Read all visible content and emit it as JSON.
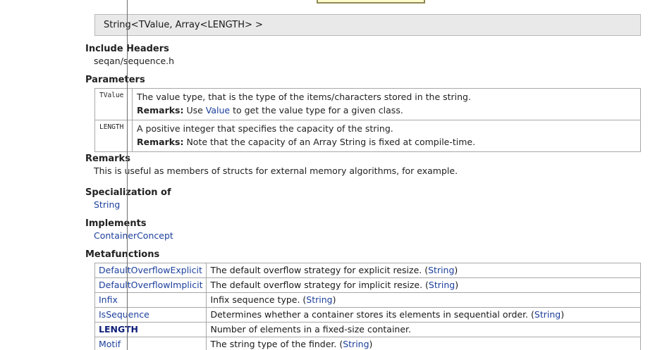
{
  "signature": "String<TValue, Array<LENGTH> >",
  "sections": {
    "include_headers": {
      "heading": "Include Headers",
      "value": "seqan/sequence.h"
    },
    "parameters": {
      "heading": "Parameters",
      "items": [
        {
          "name": "TValue",
          "desc": "The value type, that is the type of the items/characters stored in the string.",
          "remarks_label": "Remarks:",
          "remarks_pre": " Use ",
          "remarks_link": "Value",
          "remarks_post": " to get the value type for a given class."
        },
        {
          "name": "LENGTH",
          "desc": "A positive integer that specifies the capacity of the string.",
          "remarks_label": "Remarks:",
          "remarks_text": " Note that the capacity of an Array String is fixed at compile-time."
        }
      ]
    },
    "remarks": {
      "heading": "Remarks",
      "text": "This is useful as members of structs for external memory algorithms, for example."
    },
    "specialization": {
      "heading": "Specialization of",
      "link": "String"
    },
    "implements": {
      "heading": "Implements",
      "link": "ContainerConcept"
    },
    "metafunctions": {
      "heading": "Metafunctions",
      "rows": [
        {
          "name": "DefaultOverflowExplicit",
          "desc": "The default overflow strategy for explicit resize. (",
          "link": "String",
          "close": ")"
        },
        {
          "name": "DefaultOverflowImplicit",
          "desc": "The default overflow strategy for implicit resize. (",
          "link": "String",
          "close": ")"
        },
        {
          "name": "Infix",
          "desc": "Infix sequence type. (",
          "link": "String",
          "close": ")"
        },
        {
          "name": "IsSequence",
          "desc": "Determines whether a container stores its elements in sequential order. (",
          "link": "String",
          "close": ")"
        },
        {
          "name": "LENGTH",
          "desc": "Number of elements in a fixed-size container."
        },
        {
          "name": "Motif",
          "desc": "The string type of the finder. (",
          "link": "String",
          "close": ")"
        }
      ]
    }
  }
}
